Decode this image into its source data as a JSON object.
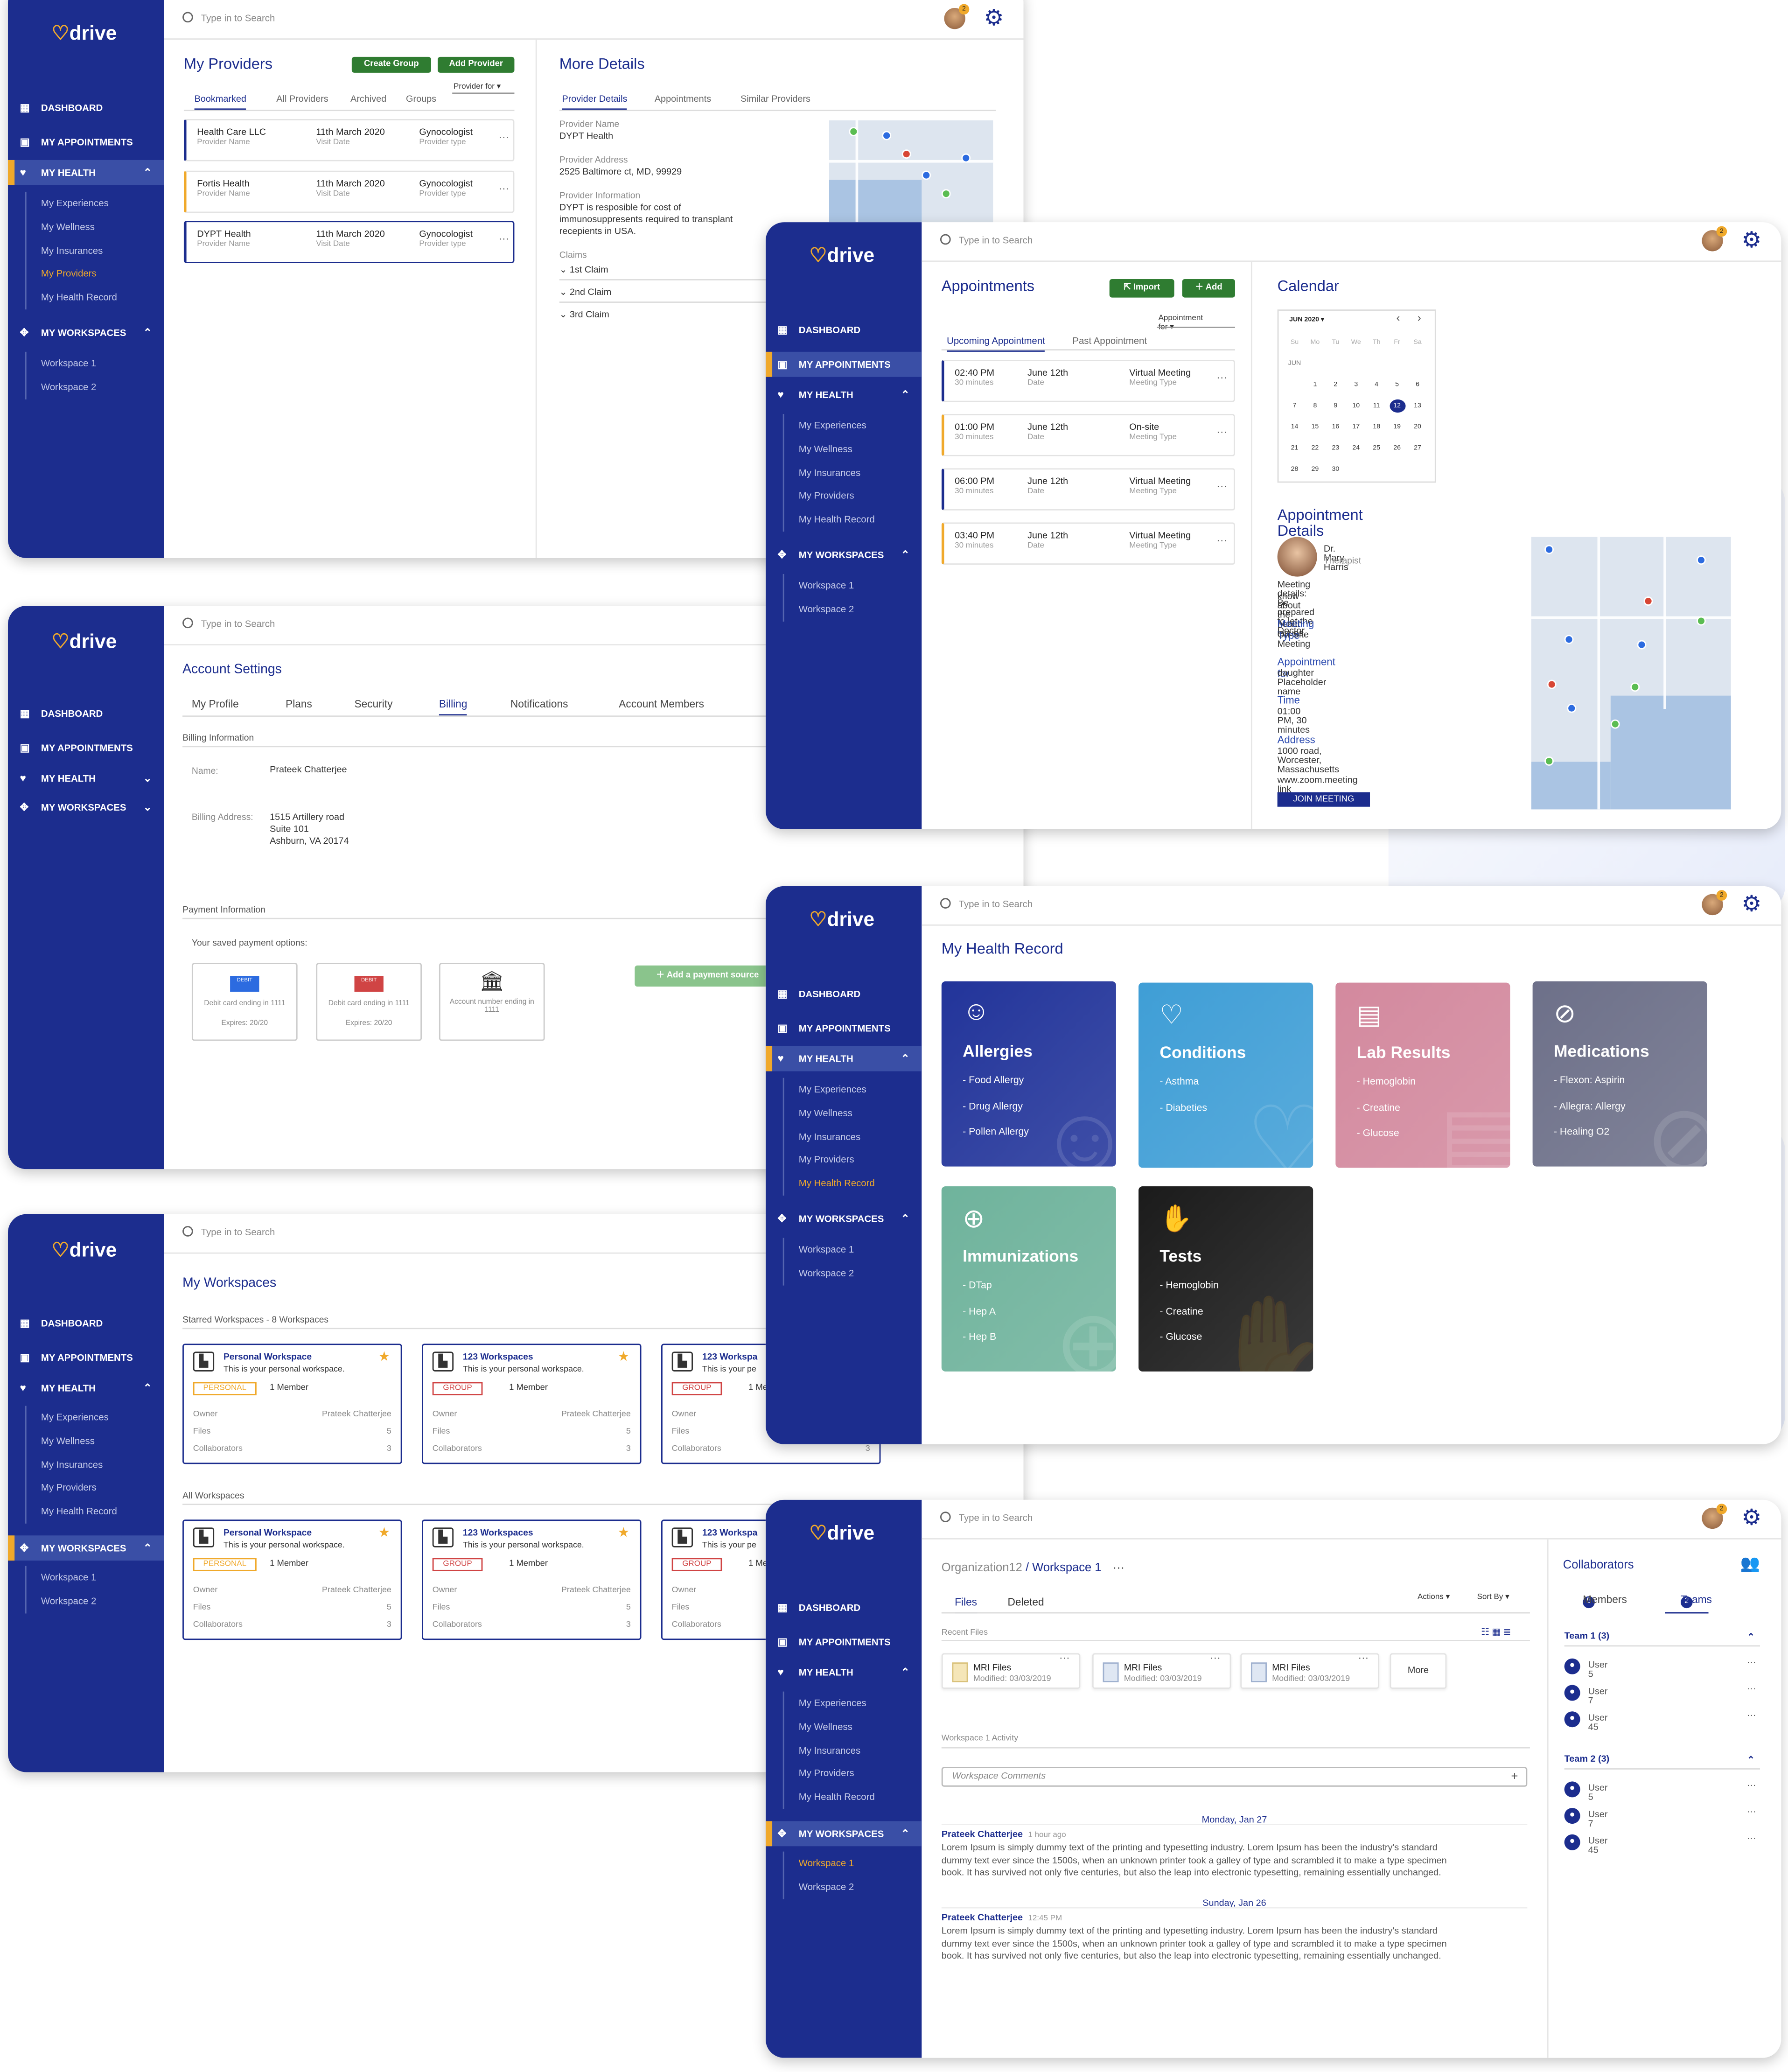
{
  "brand": {
    "logo": "drive",
    "accent": "#f0a92b",
    "primary": "#1c2d8e",
    "green": "#2f7c31"
  },
  "common": {
    "search_placeholder": "Type in to Search",
    "notif_count": "2"
  },
  "nav": {
    "dashboard": "DASHBOARD",
    "appointments": "MY APPOINTMENTS",
    "health": "MY HEALTH",
    "workspaces": "MY WORKSPACES",
    "health_items": [
      "My Experiences",
      "My Wellness",
      "My Insurances",
      "My Providers",
      "My Health Record"
    ],
    "workspace_items": [
      "Workspace 1",
      "Workspace 2"
    ]
  },
  "providers": {
    "title": "My Providers",
    "create_group": "Create Group",
    "add_provider": "Add Provider",
    "provider_for": "Provider for",
    "tabs": [
      "Bookmarked",
      "All Providers",
      "Archived",
      "Groups"
    ],
    "cards": [
      {
        "name": "Health Care LLC",
        "name_label": "Provider Name",
        "date": "11th March 2020",
        "date_label": "Visit Date",
        "type": "Gynocologist",
        "type_label": "Provider type"
      },
      {
        "name": "Fortis Health",
        "name_label": "Provider Name",
        "date": "11th March 2020",
        "date_label": "Visit Date",
        "type": "Gynocologist",
        "type_label": "Provider type"
      },
      {
        "name": "DYPT Health",
        "name_label": "Provider Name",
        "date": "11th March 2020",
        "date_label": "Visit Date",
        "type": "Gynocologist",
        "type_label": "Provider type"
      }
    ],
    "more_title": "More Details",
    "more_tabs": [
      "Provider Details",
      "Appointments",
      "Similar Providers"
    ],
    "name_label": "Provider Name",
    "name_value": "DYPT Health",
    "address_label": "Provider Address",
    "address_value": "2525 Baltimore ct, MD, 99929",
    "info_label": "Provider Information",
    "info_lines": [
      "DYPT is resposible for cost of",
      "immunosuppresents required to transplant",
      "recepients in USA."
    ],
    "claims_label": "Claims",
    "claims": [
      "1st Claim",
      "2nd Claim",
      "3rd Claim"
    ]
  },
  "account": {
    "title": "Account Settings",
    "tabs": [
      "My Profile",
      "Plans",
      "Security",
      "Billing",
      "Notifications",
      "Account Members"
    ],
    "billing_info": "Billing Information",
    "name_label": "Name:",
    "name_value": "Prateek Chatterjee",
    "address_label": "Billing Address:",
    "address_lines": [
      "1515 Artillery road",
      "Suite 101",
      "Ashburn, VA 20174"
    ],
    "payment_info": "Payment Information",
    "saved_options": "Your saved payment options:",
    "cards": [
      {
        "badge": "DEBIT",
        "text": "Debit card ending in 1111",
        "exp": "Expires: 20/20"
      },
      {
        "badge": "DEBIT",
        "text": "Debit card ending in 1111",
        "exp": "Expires: 20/20"
      },
      {
        "text": "Account number ending in 1111"
      }
    ],
    "add_source": "Add a payment source"
  },
  "workspaces": {
    "title": "My Workspaces",
    "starred": "Starred Workspaces - 8 Workspaces",
    "all": "All Workspaces",
    "cards": [
      {
        "name": "Personal Workspace",
        "desc": "This is your personal workspace.",
        "tag": "PERSONAL",
        "members": "1 Member",
        "owner": "Prateek Chatterjee",
        "files": "5",
        "collab": "3"
      },
      {
        "name": "123 Workspaces",
        "desc": "This is your personal workspace.",
        "tag": "GROUP",
        "members": "1 Member",
        "owner": "Prateek Chatterjee",
        "files": "5",
        "collab": "3"
      },
      {
        "name": "123 Workspa",
        "desc": "This is your pe",
        "tag": "GROUP",
        "members": "1 Memb",
        "owner": "",
        "files": "",
        "collab": "3"
      }
    ],
    "owner_label": "Owner",
    "files_label": "Files",
    "collab_label": "Collaborators"
  },
  "appointments": {
    "title": "Appointments",
    "import": "Import",
    "add": "Add",
    "appt_for": "Appointment for",
    "tabs": [
      "Upcoming Appointment",
      "Past Appointment"
    ],
    "cards": [
      {
        "time": "02:40 PM",
        "dur": "30 minutes",
        "date": "June 12th",
        "date_label": "Date",
        "type": "Virtual Meeting",
        "type_label": "Meeting Type"
      },
      {
        "time": "01:00 PM",
        "dur": "30 minutes",
        "date": "June 12th",
        "date_label": "Date",
        "type": "On-site",
        "type_label": "Meeting Type"
      },
      {
        "time": "06:00 PM",
        "dur": "30 minutes",
        "date": "June 12th",
        "date_label": "Date",
        "type": "Virtual Meeting",
        "type_label": "Meeting Type"
      },
      {
        "time": "03:40 PM",
        "dur": "30 minutes",
        "date": "June 12th",
        "date_label": "Date",
        "type": "Virtual Meeting",
        "type_label": "Meeting Type"
      }
    ],
    "calendar_title": "Calendar",
    "month": "JUN 2020",
    "month_short": "JUN",
    "weekdays": [
      "Su",
      "Mo",
      "Tu",
      "We",
      "Th",
      "Fr",
      "Sa"
    ],
    "weeks": [
      [
        "",
        "1",
        "2",
        "3",
        "4",
        "5",
        "6"
      ],
      [
        "7",
        "8",
        "9",
        "10",
        "11",
        "12",
        "13"
      ],
      [
        "14",
        "15",
        "16",
        "17",
        "18",
        "19",
        "20"
      ],
      [
        "21",
        "22",
        "23",
        "24",
        "25",
        "26",
        "27"
      ],
      [
        "28",
        "29",
        "30",
        "",
        "",
        "",
        ""
      ]
    ],
    "selected_day": "12",
    "details_title": "Appointment Details",
    "doctor": "Dr. Mary Harris",
    "doctor_role": "Therapist",
    "meeting_details": [
      "Meeting details: Be prepared to let the Doctor",
      "know about the health issues."
    ],
    "meeting_type_label": "Meeting Type",
    "meeting_type": "On-Site Meeting",
    "appt_for_label": "Appointment for",
    "appt_for_value": "daughter Placeholder name",
    "time_label": "Time",
    "time_value": "01:00 PM, 30 minutes",
    "address_label": "Address",
    "address_value": "1000 road, Worcester, Massachusetts",
    "link": "www.zoom.meeting link",
    "join": "JOIN MEETING"
  },
  "health_record": {
    "title": "My Health Record",
    "tiles": [
      {
        "title": "Allergies",
        "items": [
          "- Food Allergy",
          "- Drug Allergy",
          "- Pollen Allergy"
        ],
        "color": "#22349a"
      },
      {
        "title": "Conditions",
        "items": [
          "- Asthma",
          "- Diabeties"
        ],
        "color": "#3f9ed6"
      },
      {
        "title": "Lab Results",
        "items": [
          "- Hemoglobin",
          "- Creatine",
          "- Glucose"
        ],
        "color": "#d3899e"
      },
      {
        "title": "Medications",
        "items": [
          "- Flexon: Aspirin",
          "- Allegra: Allergy",
          "- Healing O2"
        ],
        "color": "#6d7089"
      },
      {
        "title": "Immunizations",
        "items": [
          "- DTap",
          "- Hep A",
          "- Hep B"
        ],
        "color": "#6fb39c"
      },
      {
        "title": "Tests",
        "items": [
          "- Hemoglobin",
          "- Creatine",
          "- Glucose"
        ],
        "color": "#1b1b1b"
      }
    ]
  },
  "workspace_detail": {
    "org": "Organization12",
    "title": "/ Workspace 1",
    "tabs": [
      "Files",
      "Deleted"
    ],
    "actions": "Actions",
    "sort": "Sort By",
    "recent": "Recent Files",
    "files": [
      {
        "name": "MRI Files",
        "mod": "Modified: 03/03/2019"
      },
      {
        "name": "MRI Files",
        "mod": "Modified: 03/03/2019"
      },
      {
        "name": "MRI Files",
        "mod": "Modified: 03/03/2019"
      }
    ],
    "more": "More",
    "activity": "Workspace 1 Activity",
    "comments_placeholder": "Workspace Comments",
    "day1": "Monday, Jan 27",
    "day2": "Sunday, Jan 26",
    "c1_author": "Prateek Chatterjee",
    "c1_time": "1 hour ago",
    "c2_author": "Prateek Chatterjee",
    "c2_time": "12:45 PM",
    "lorem": [
      "Lorem Ipsum is simply dummy text of the printing and typesetting industry. Lorem Ipsum has been the industry's standard",
      "dummy text ever since the 1500s, when an unknown printer took a galley of type and scrambled it to make a type specimen",
      "book. It has survived not only five centuries, but also the leap into electronic typesetting, remaining essentially unchanged."
    ],
    "collab_title": "Collaborators",
    "members_tab": "Members",
    "members_count": "5",
    "teams_tab": "Teams",
    "teams_count": "2",
    "team1": "Team 1 (3)",
    "team2": "Team 2 (3)",
    "team_users": [
      "User 5",
      "User 7",
      "User 45"
    ]
  }
}
